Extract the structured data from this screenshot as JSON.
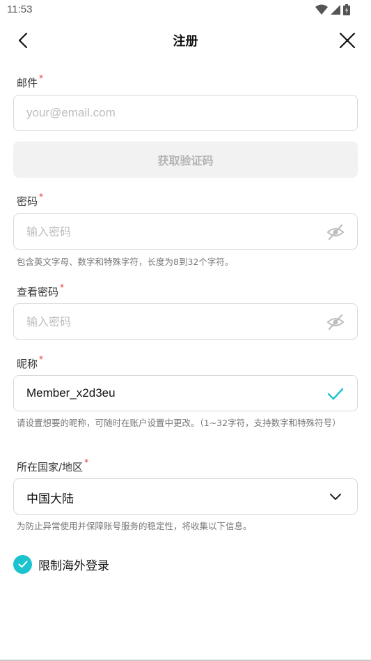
{
  "status_bar": {
    "time": "11:53"
  },
  "header": {
    "title": "注册"
  },
  "email": {
    "label": "邮件",
    "required_mark": "*",
    "placeholder": "your@email.com"
  },
  "get_code_button": {
    "label": "获取验证码"
  },
  "password": {
    "label": "密码",
    "required_mark": "*",
    "placeholder": "输入密码",
    "hint": "包含英文字母、数字和特殊字符，长度为8到32个字符。"
  },
  "confirm_password": {
    "label": "查看密码",
    "required_mark": "*",
    "placeholder": "输入密码"
  },
  "nickname": {
    "label": "昵称",
    "required_mark": "*",
    "value": "Member_x2d3eu",
    "hint": "请设置想要的昵称，可随时在账户设置中更改。（1~32字符，支持数字和特殊符号）"
  },
  "country": {
    "label": "所在国家/地区",
    "required_mark": "*",
    "value": "中国大陆",
    "hint": "为防止异常使用并保障账号服务的稳定性，将收集以下信息。"
  },
  "restrict_overseas": {
    "label": "限制海外登录",
    "checked": true
  },
  "icons": {
    "back": "chevron-left-icon",
    "close": "close-icon",
    "eye_off": "eye-off-icon",
    "check": "checkmark-icon",
    "dropdown": "chevron-down-icon"
  },
  "colors": {
    "accent": "#1cc3cf",
    "required": "#e03a3a",
    "border": "#d9d9d9",
    "disabled_bg": "#f2f2f2",
    "disabled_text": "#b5b5b5"
  }
}
